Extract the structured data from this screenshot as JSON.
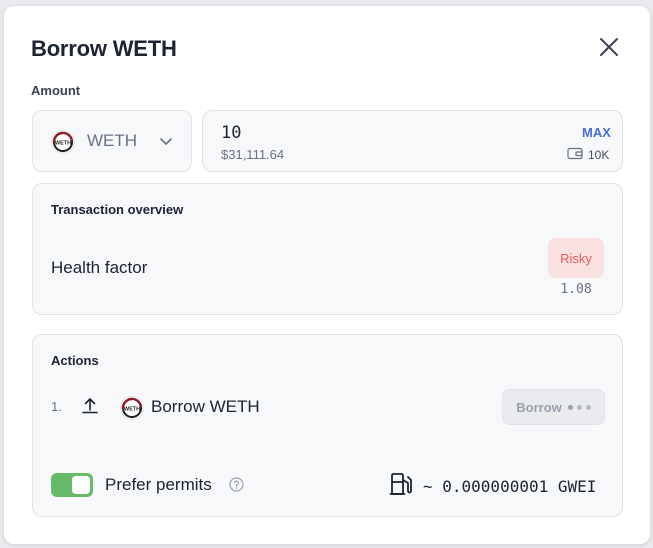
{
  "modal": {
    "title": "Borrow WETH",
    "amount_label": "Amount"
  },
  "asset": {
    "symbol": "WETH",
    "logo_text": "WETH",
    "icon": "weth-token-icon"
  },
  "amount": {
    "value": "10",
    "usd_value": "$31,111.64",
    "max_label": "MAX",
    "balance": "10K",
    "balance_icon": "wallet-icon"
  },
  "overview": {
    "title": "Transaction overview",
    "health_factor_label": "Health factor",
    "risk_badge": "Risky",
    "health_factor_value": "1.08"
  },
  "actions": {
    "title": "Actions",
    "step_number": "1.",
    "step_label": "Borrow WETH",
    "borrow_button_label": "Borrow",
    "prefer_permits_label": "Prefer permits",
    "prefer_permits_enabled": true,
    "gas_estimate": "~ 0.000000001 GWEI"
  },
  "colors": {
    "accent": "#4a6ee0",
    "risky_bg": "#fbe2e2",
    "risky_text": "#e45a5a",
    "toggle_on": "#66bb6a"
  }
}
